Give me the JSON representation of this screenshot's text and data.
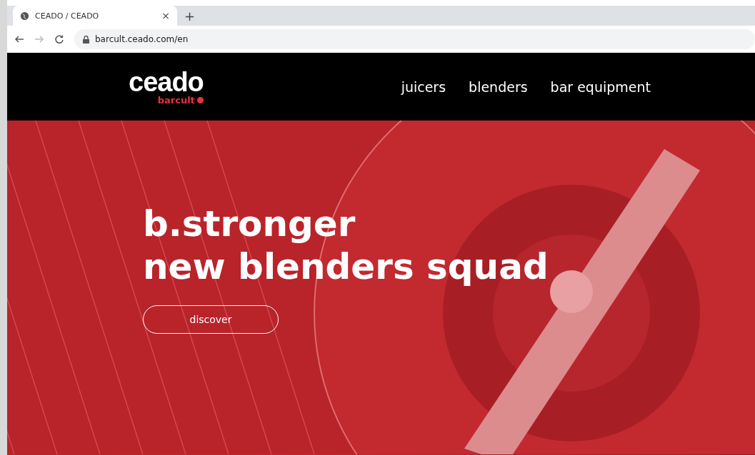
{
  "browser": {
    "tab": {
      "title": "CEADO / CEADO",
      "close": "×"
    },
    "new_tab": "+",
    "address": "barcult.ceado.com/en"
  },
  "header": {
    "logo": {
      "brand": "ceado",
      "sub": "barcult"
    },
    "nav": [
      "juicers",
      "blenders",
      "bar equipment"
    ]
  },
  "hero": {
    "heading_lines": [
      "b.stronger",
      "new blenders squad"
    ],
    "button": "discover"
  }
}
